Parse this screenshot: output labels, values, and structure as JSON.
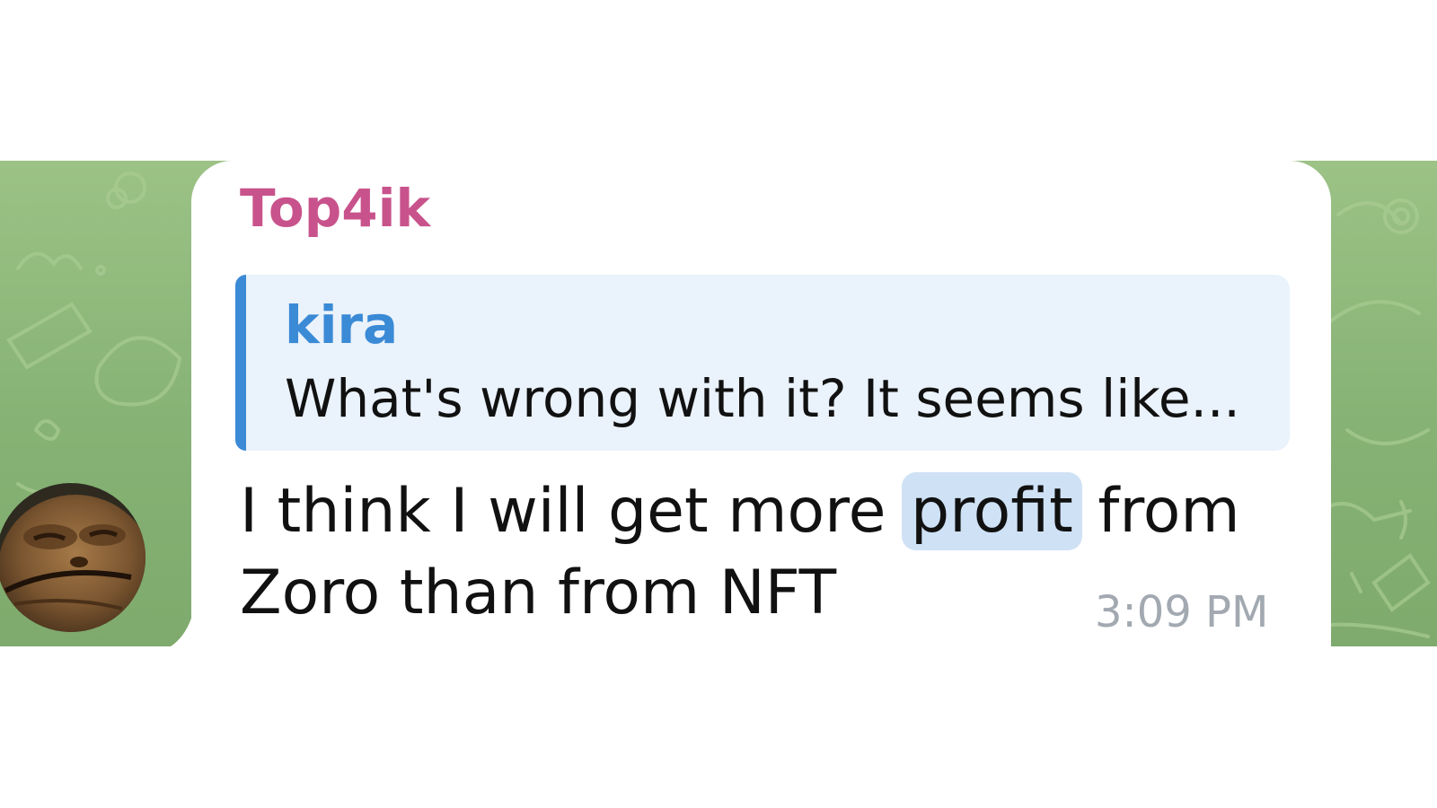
{
  "message": {
    "sender": "Top4ik",
    "reply": {
      "author": "kira",
      "text": "What's wrong with it? It seems like..."
    },
    "text_part1": "I think I will get more ",
    "highlight": "profit",
    "text_part2": " from",
    "text_line2": "Zoro than from NFT",
    "time": "3:09 PM"
  },
  "colors": {
    "sender": "#c8538c",
    "reply_accent": "#3a8ad6",
    "reply_background": "#eaf2fb",
    "highlight": "#cfe1f5",
    "wallpaper": "#8fb87a",
    "time": "#a2a9b1"
  },
  "icons": {
    "avatar": "sender-avatar-photo"
  }
}
